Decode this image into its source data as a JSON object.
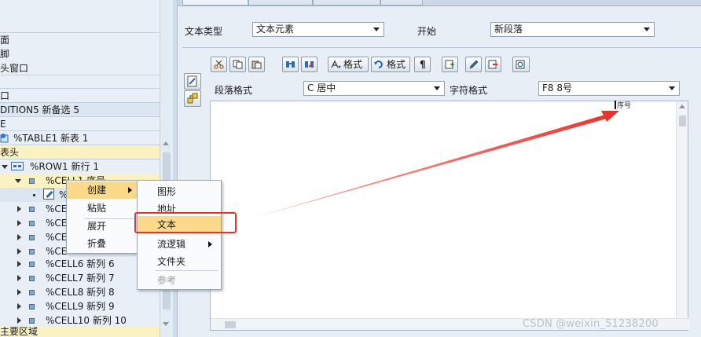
{
  "tree": {
    "rows": [
      {
        "label": "面"
      },
      {
        "label": "脚"
      },
      {
        "label": "头窗口"
      },
      {
        "label": "口"
      },
      {
        "label": "DITION5 新备选 5"
      },
      {
        "label": "E"
      },
      {
        "label": "%TABLE1 新表 1"
      },
      {
        "label": "表头"
      },
      {
        "label": "%ROW1 新行 1"
      },
      {
        "label": "%CELL1 序号"
      },
      {
        "label": "%"
      },
      {
        "label": "%CE"
      },
      {
        "label": "%CE"
      },
      {
        "label": "%CE"
      },
      {
        "label": "%CE"
      },
      {
        "label": "%CELL6 新列 6"
      },
      {
        "label": "%CELL7 新列 7"
      },
      {
        "label": "%CELL8 新列 8"
      },
      {
        "label": "%CELL9 新列 9"
      },
      {
        "label": "%CELL10 新列 10"
      },
      {
        "label": "主要区域"
      }
    ]
  },
  "tabs": [
    "",
    "",
    "",
    ""
  ],
  "form": {
    "text_type_label": "文本类型",
    "text_type_value": "文本元素",
    "start_label": "开始",
    "start_value": "新段落",
    "para_format_label": "段落格式",
    "para_format_value": "C 居中",
    "char_format_label": "字符格式",
    "char_format_value": "F8 8号"
  },
  "toolbar": {
    "format1": "格式",
    "format2": "格式",
    "icons": [
      "cut-icon",
      "copy-icon",
      "paste-icon",
      "find-icon",
      "find-replace-icon",
      "format-icon",
      "undo-format-icon",
      "paragraph-mark-icon",
      "insert-icon",
      "edit-icon",
      "delete-icon",
      "preview-icon"
    ]
  },
  "editor": {
    "cursor_text": "序号"
  },
  "context_menu": {
    "items": [
      "创建",
      "粘贴",
      "展开",
      "折叠"
    ]
  },
  "submenu": {
    "items": [
      "图形",
      "地址",
      "文本",
      "流逻辑",
      "文件夹",
      "参考"
    ]
  },
  "watermark": "CSDN @weixin_51238200",
  "colors": {
    "highlight": "#fbd98a",
    "annotation_red": "#e8322a"
  }
}
